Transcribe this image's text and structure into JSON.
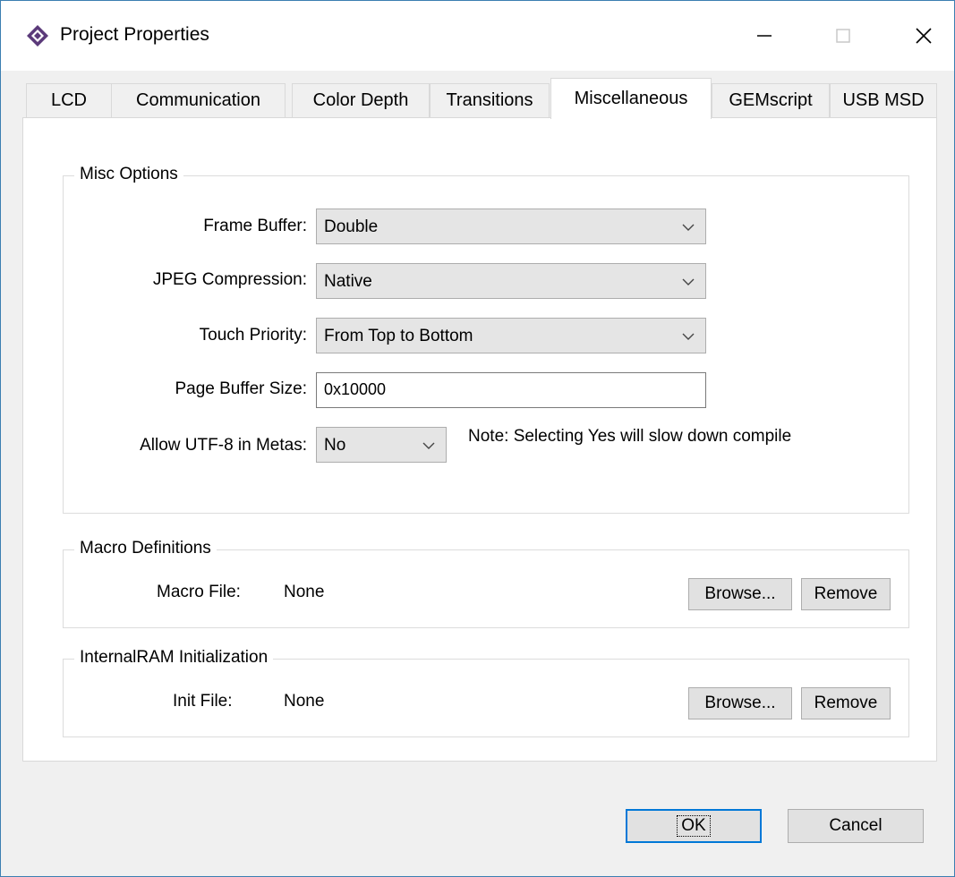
{
  "window": {
    "title": "Project Properties"
  },
  "tabs": [
    {
      "label": "LCD"
    },
    {
      "label": "Communication"
    },
    {
      "label": "Color Depth"
    },
    {
      "label": "Transitions"
    },
    {
      "label": "Miscellaneous",
      "active": true
    },
    {
      "label": "GEMscript"
    },
    {
      "label": "USB MSD"
    }
  ],
  "misc": {
    "title": "Misc Options",
    "frame_buffer": {
      "label": "Frame Buffer:",
      "value": "Double"
    },
    "jpeg_compression": {
      "label": "JPEG Compression:",
      "value": "Native"
    },
    "touch_priority": {
      "label": "Touch Priority:",
      "value": "From Top to Bottom"
    },
    "page_buffer": {
      "label": "Page Buffer Size:",
      "value": "0x10000"
    },
    "utf8": {
      "label": "Allow UTF-8 in Metas:",
      "value": "No"
    },
    "note": "Note: Selecting Yes will slow down compile"
  },
  "macro": {
    "title": "Macro Definitions",
    "file_label": "Macro File:",
    "file_value": "None",
    "browse": "Browse...",
    "remove": "Remove"
  },
  "ram": {
    "title": "InternalRAM Initialization",
    "file_label": "Init File:",
    "file_value": "None",
    "browse": "Browse...",
    "remove": "Remove"
  },
  "footer": {
    "ok": "OK",
    "cancel": "Cancel"
  },
  "colors": {
    "accent": "#0078d7",
    "window_border": "#3c7fb1",
    "app_icon": "#5b3a7a"
  }
}
